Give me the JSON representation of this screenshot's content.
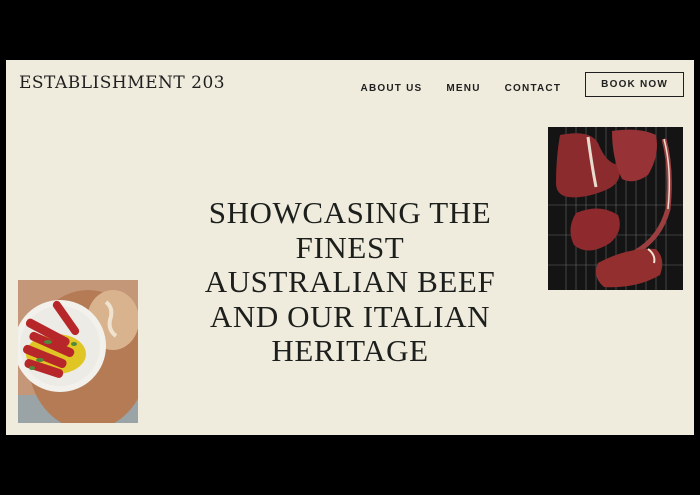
{
  "brand": {
    "logo": "ESTABLISHMENT 203"
  },
  "nav": {
    "items": [
      "ABOUT US",
      "MENU",
      "CONTACT"
    ],
    "cta": "BOOK NOW"
  },
  "hero": {
    "lines": [
      "SHOWCASING THE",
      "FINEST",
      "AUSTRALIAN BEEF",
      "AND OUR ITALIAN",
      "HERITAGE"
    ]
  },
  "images": {
    "left": "anchovy-plate-image",
    "right": "raw-steaks-image"
  },
  "colors": {
    "background": "#efebdd",
    "text": "#1f1f1f",
    "frame": "#000000"
  }
}
